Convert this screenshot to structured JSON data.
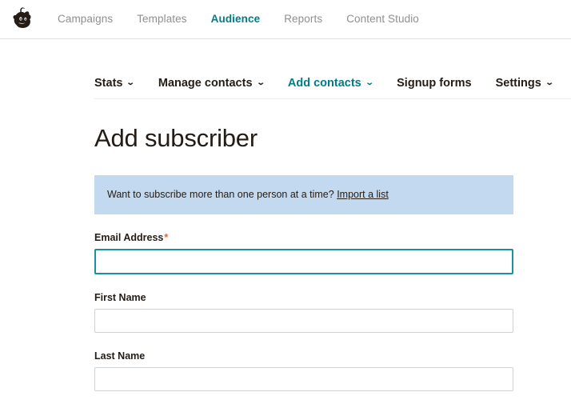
{
  "colors": {
    "accent_teal": "#007c89",
    "focus_teal": "#1e8fa0",
    "banner_blue": "#c3d9ef",
    "required_orange": "#e85c41",
    "inactive_gray": "#8f8f8f",
    "text_dark": "#241c15"
  },
  "header": {
    "logo_name": "mailchimp-freddie-logo",
    "nav": [
      {
        "label": "Campaigns",
        "active": false
      },
      {
        "label": "Templates",
        "active": false
      },
      {
        "label": "Audience",
        "active": true
      },
      {
        "label": "Reports",
        "active": false
      },
      {
        "label": "Content Studio",
        "active": false
      }
    ]
  },
  "subnav": {
    "items": [
      {
        "label": "Stats",
        "has_chevron": true,
        "active": false
      },
      {
        "label": "Manage contacts",
        "has_chevron": true,
        "active": false
      },
      {
        "label": "Add contacts",
        "has_chevron": true,
        "active": true
      },
      {
        "label": "Signup forms",
        "has_chevron": false,
        "active": false
      },
      {
        "label": "Settings",
        "has_chevron": true,
        "active": false
      }
    ],
    "chevron_glyph": "⌄",
    "search_icon": "search-icon"
  },
  "main": {
    "title": "Add subscriber",
    "banner": {
      "text": "Want to subscribe more than one person at a time?",
      "link_label": "Import a list"
    },
    "fields": [
      {
        "label": "Email Address",
        "required": true,
        "required_marker": "*",
        "value": "",
        "placeholder": "",
        "focused": true
      },
      {
        "label": "First Name",
        "required": false,
        "required_marker": "",
        "value": "",
        "placeholder": "",
        "focused": false
      },
      {
        "label": "Last Name",
        "required": false,
        "required_marker": "",
        "value": "",
        "placeholder": "",
        "focused": false
      }
    ]
  }
}
